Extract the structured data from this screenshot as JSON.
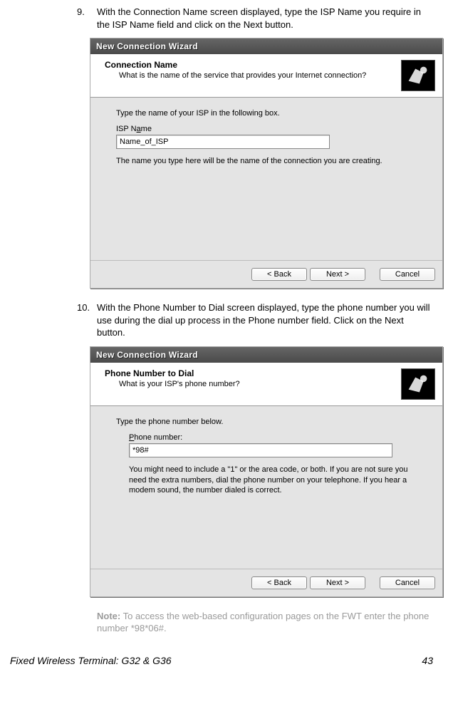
{
  "steps": {
    "s9": {
      "num": "9.",
      "text": "With the Connection Name screen displayed, type the ISP Name you require in the ISP Name field and click on the Next button."
    },
    "s10": {
      "num": "10.",
      "text": "With the Phone Number to Dial screen displayed, type the phone number you will use during the dial up process in the Phone number field.  Click on the Next button."
    }
  },
  "wizard1": {
    "title": "New Connection Wizard",
    "header_title": "Connection Name",
    "header_sub": "What is the name of the service that provides your Internet connection?",
    "instr": "Type the name of your ISP in the following box.",
    "field_label_pre": "ISP N",
    "field_label_u": "a",
    "field_label_post": "me",
    "field_value": "Name_of_ISP",
    "hint": "The name you type here will be the name of the connection you are creating.",
    "btn_back": "< Back",
    "btn_next": "Next >",
    "btn_cancel": "Cancel"
  },
  "wizard2": {
    "title": "New Connection Wizard",
    "header_title": "Phone Number to Dial",
    "header_sub": "What is your ISP's phone number?",
    "instr": "Type the phone number below.",
    "field_label_u": "P",
    "field_label_post": "hone number:",
    "field_value": "*98#",
    "hint": "You might need to include a \"1\" or the area code, or both. If you are not sure you need the extra numbers, dial the phone number on your telephone. If you hear a modem sound, the number dialed is correct.",
    "btn_back_pre": "< ",
    "btn_back_u": "B",
    "btn_back_post": "ack",
    "btn_next_u": "N",
    "btn_next_post": "ext >",
    "btn_cancel": "Cancel"
  },
  "note": {
    "label": "Note:",
    "text": " To access the web-based configuration pages on the FWT enter the phone number *98*06#."
  },
  "footer": {
    "left": "Fixed Wireless Terminal: G32 & G36",
    "right": "43"
  }
}
